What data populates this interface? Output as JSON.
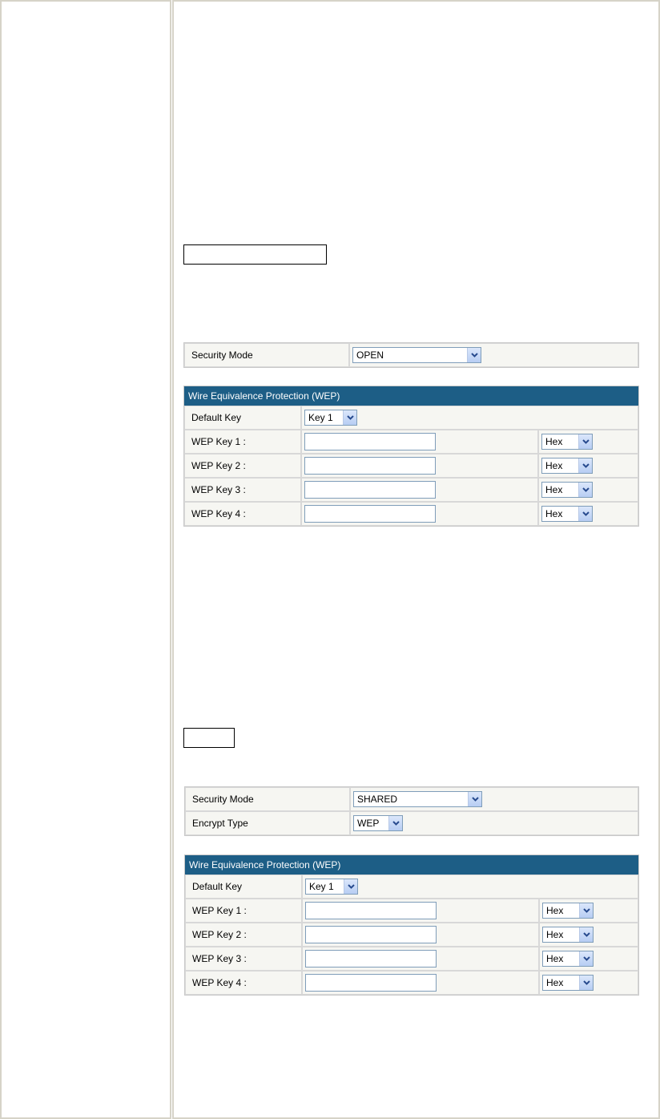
{
  "blank_label_1": "",
  "blank_label_2": "",
  "open_mode": {
    "security_mode_label": "Security Mode",
    "security_mode_value": "OPEN",
    "wep": {
      "header": "Wire Equivalence Protection (WEP)",
      "default_key_label": "Default Key",
      "default_key_value": "Key 1",
      "keys": [
        {
          "label": "WEP Key 1 :",
          "value": "",
          "format": "Hex"
        },
        {
          "label": "WEP Key 2 :",
          "value": "",
          "format": "Hex"
        },
        {
          "label": "WEP Key 3 :",
          "value": "",
          "format": "Hex"
        },
        {
          "label": "WEP Key 4 :",
          "value": "",
          "format": "Hex"
        }
      ]
    }
  },
  "shared_mode": {
    "security_mode_label": "Security Mode",
    "security_mode_value": "SHARED",
    "encrypt_type_label": "Encrypt Type",
    "encrypt_type_value": "WEP",
    "wep": {
      "header": "Wire Equivalence Protection (WEP)",
      "default_key_label": "Default Key",
      "default_key_value": "Key 1",
      "keys": [
        {
          "label": "WEP Key 1 :",
          "value": "",
          "format": "Hex"
        },
        {
          "label": "WEP Key 2 :",
          "value": "",
          "format": "Hex"
        },
        {
          "label": "WEP Key 3 :",
          "value": "",
          "format": "Hex"
        },
        {
          "label": "WEP Key 4 :",
          "value": "",
          "format": "Hex"
        }
      ]
    }
  },
  "icons": {
    "dropdown": "chevron-down-icon"
  },
  "colors": {
    "table_header": "#1d5e86",
    "table_bg": "#f6f6f2",
    "control_border": "#7f9db9"
  }
}
